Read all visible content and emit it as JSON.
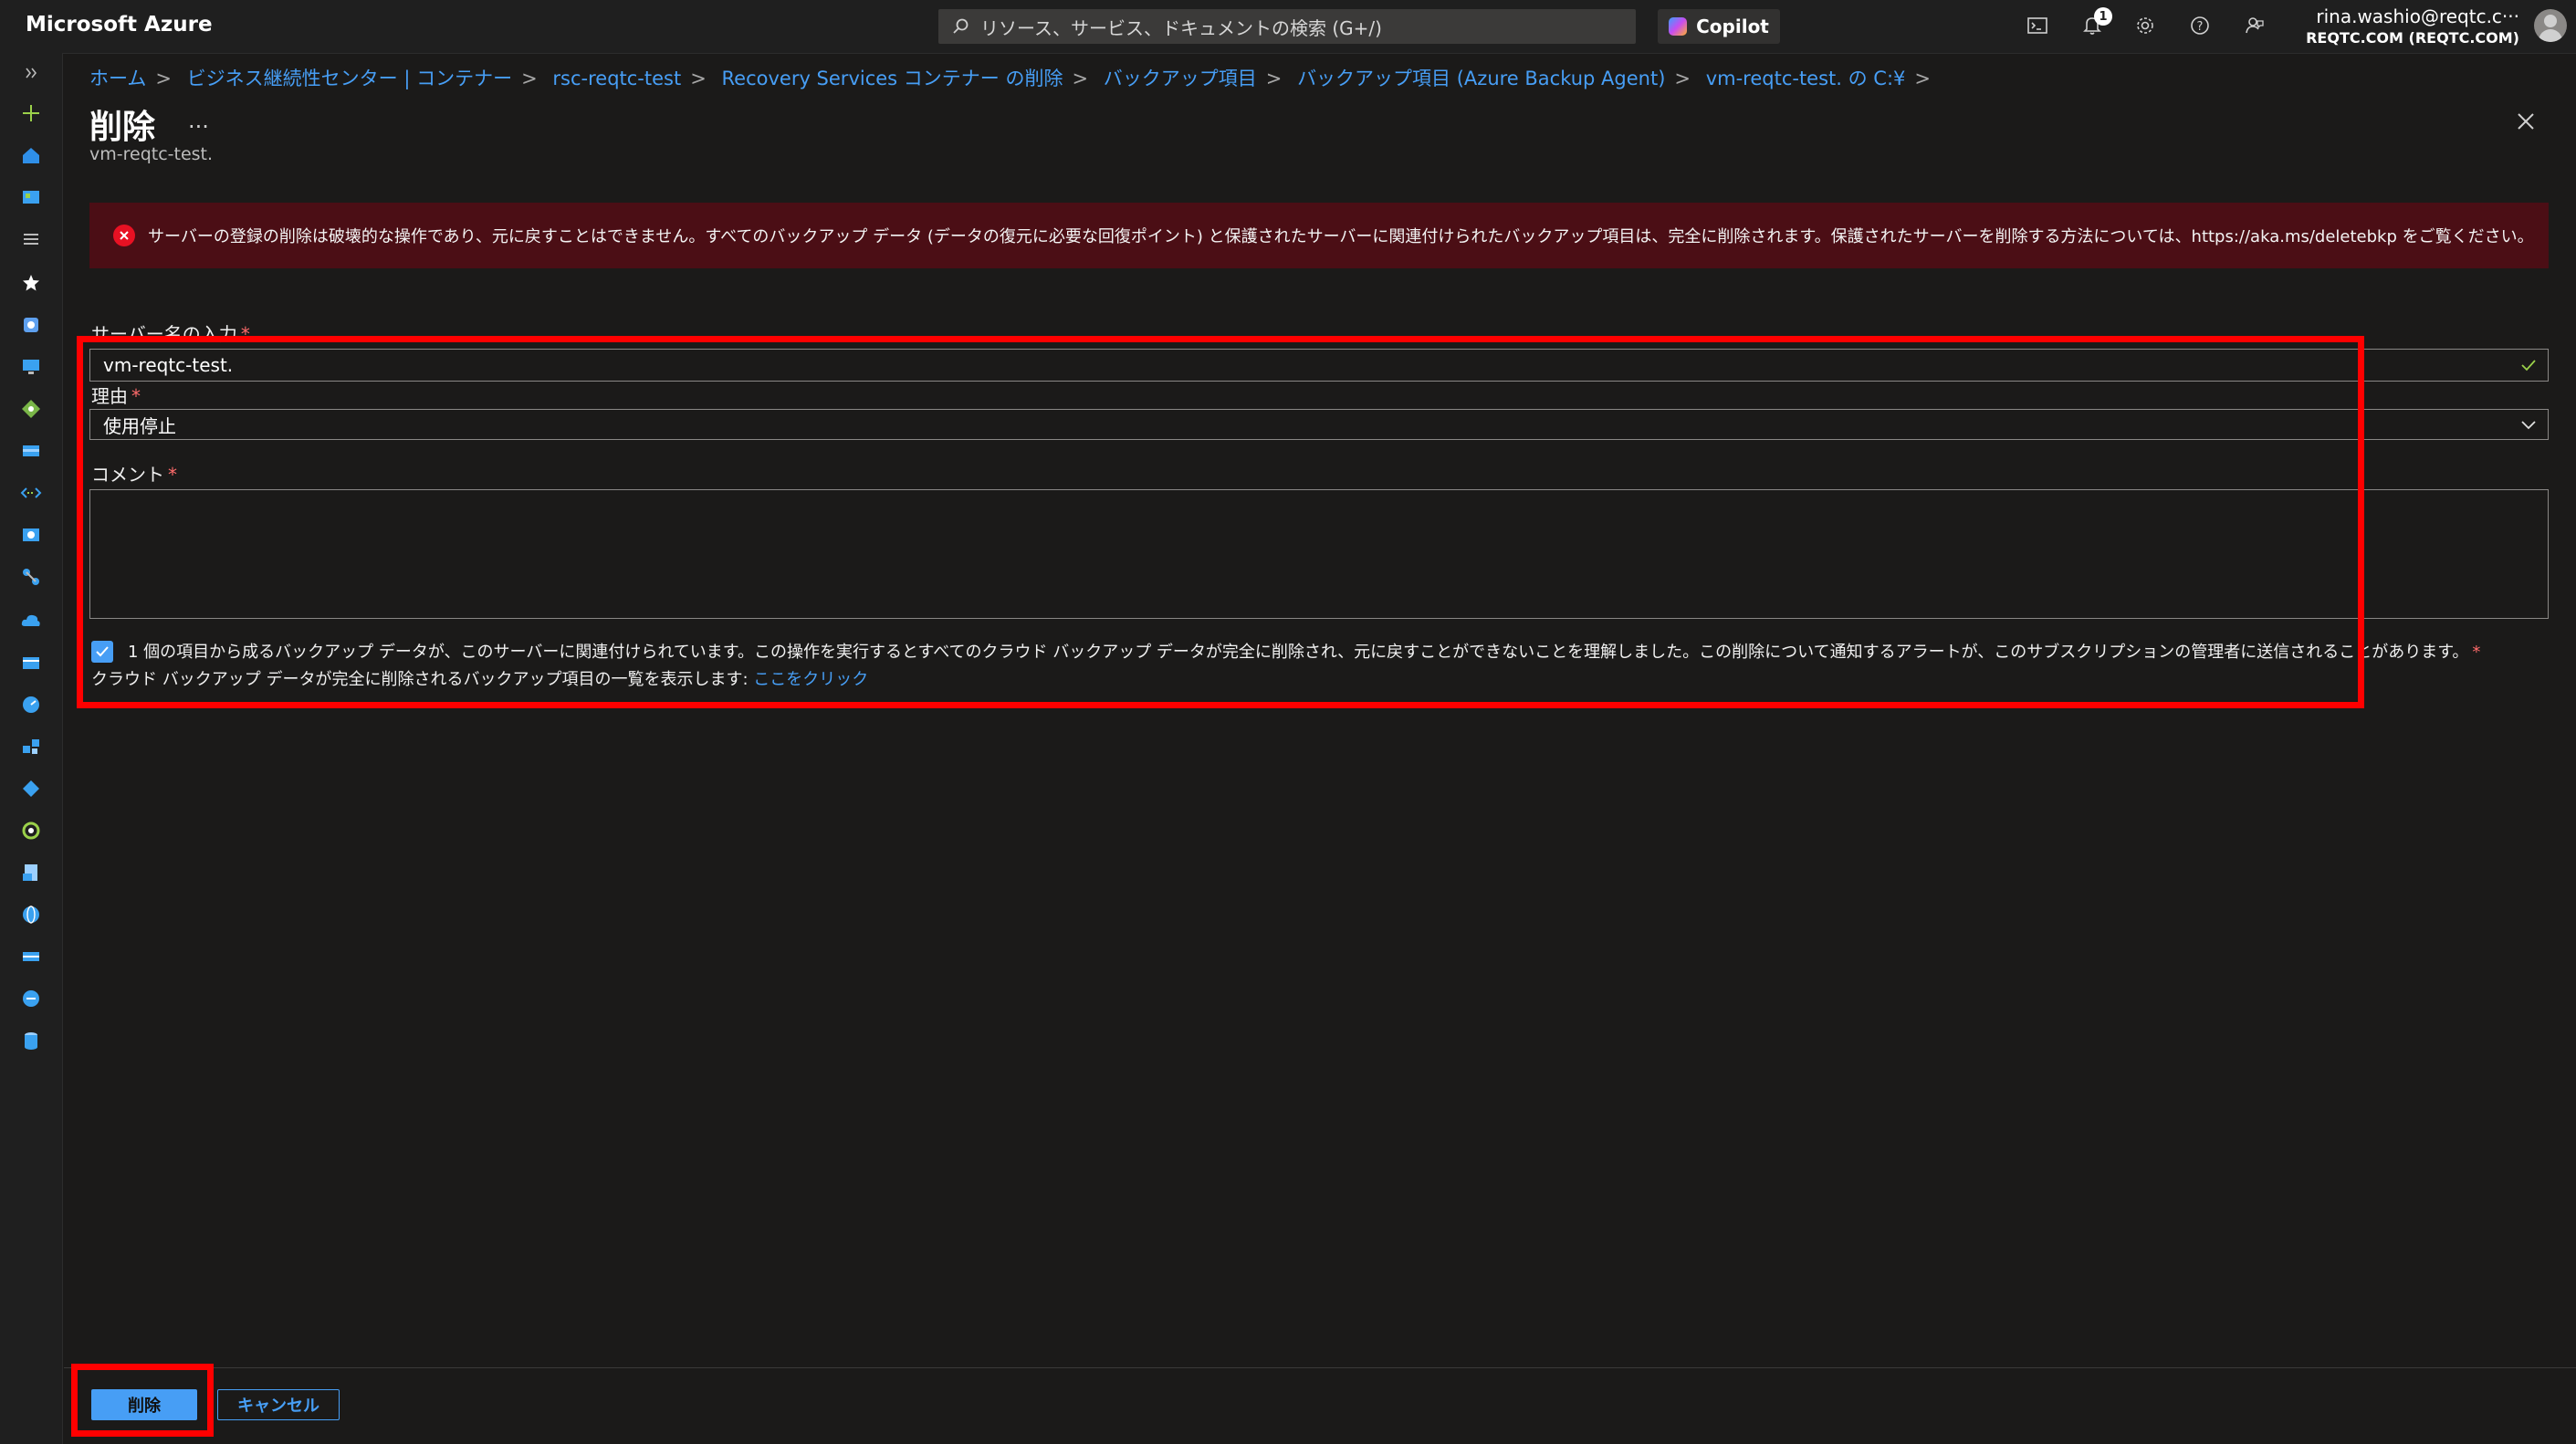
{
  "header": {
    "brand": "Microsoft Azure",
    "search_placeholder": "リソース、サービス、ドキュメントの検索 (G+/)",
    "copilot_label": "Copilot",
    "notification_count": "1",
    "user_email": "rina.washio@reqtc.c···",
    "user_tenant": "REQTC.COM (REQTC.COM)"
  },
  "breadcrumb": [
    "ホーム",
    "ビジネス継続性センター | コンテナー",
    "rsc-reqtc-test",
    "Recovery Services コンテナー の削除",
    "バックアップ項目",
    "バックアップ項目 (Azure Backup Agent)",
    "vm-reqtc-test. の C:¥"
  ],
  "page": {
    "title": "削除",
    "more": "...",
    "subtitle": "vm-reqtc-test."
  },
  "error": {
    "message": "サーバーの登録の削除は破壊的な操作であり、元に戻すことはできません。すべてのバックアップ データ (データの復元に必要な回復ポイント) と保護されたサーバーに関連付けられたバックアップ項目は、完全に削除されます。保護されたサーバーを削除する方法については、https://aka.ms/deletebkp をご覧ください。"
  },
  "form": {
    "server_name_label": "サーバー名の入力",
    "server_name_value": "vm-reqtc-test.",
    "reason_label": "理由",
    "reason_value": "使用停止",
    "comment_label": "コメント",
    "required_mark": "*",
    "confirm_text": "1 個の項目から成るバックアップ データが、このサーバーに関連付けられています。この操作を実行するとすべてのクラウド バックアップ データが完全に削除され、元に戻すことができないことを理解しました。この削除について通知するアラートが、このサブスクリプションの管理者に送信されることがあります。",
    "list_text": "クラウド バックアップ データが完全に削除されるバックアップ項目の一覧を表示します: ",
    "list_link": "ここをクリック",
    "confirm_checked": true
  },
  "footer": {
    "delete_label": "削除",
    "cancel_label": "キャンセル"
  },
  "rail_icons": [
    "expand-icon",
    "plus-icon",
    "home-icon",
    "dashboard-icon",
    "list-icon",
    "star-icon",
    "service-icon-1",
    "monitor-icon",
    "git-icon",
    "storage-icon",
    "network-icon",
    "vm-icon",
    "connector-icon",
    "cloud-icon",
    "card-icon",
    "gauge-icon",
    "cluster-icon",
    "diamond-icon",
    "ring-icon",
    "doc-icon",
    "globe-icon",
    "bar-icon",
    "circle-icon",
    "sql-icon"
  ],
  "colors": {
    "accent": "#479ef5",
    "error_bg": "#4b0e15",
    "highlight": "#ff0000"
  }
}
